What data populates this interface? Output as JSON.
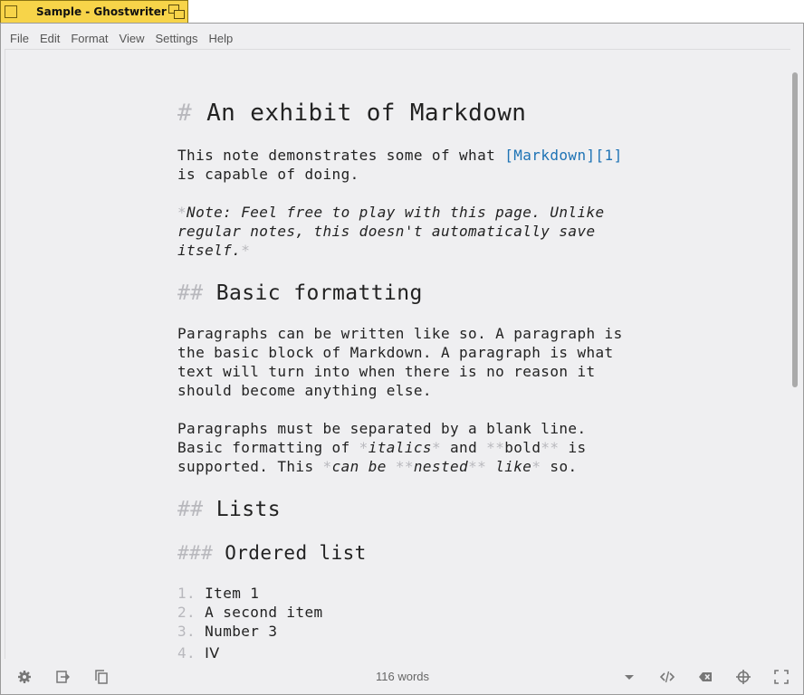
{
  "window": {
    "title": "Sample - Ghostwriter"
  },
  "menu": [
    "File",
    "Edit",
    "Format",
    "View",
    "Settings",
    "Help"
  ],
  "document": {
    "h1_marker": "#",
    "h1_text": "An exhibit of Markdown",
    "p1_line1_a": "This note demonstrates some of what ",
    "p1_link": "[Markdown][1]",
    "p1_line2": "is capable of doing.",
    "note_star_open": "*",
    "note_line1": "Note: Feel free to play with this page. Unlike",
    "note_line2": "regular notes, this doesn't automatically save",
    "note_line3": "itself.",
    "note_star_close": "*",
    "h2a_marker": "##",
    "h2a_text": "Basic formatting",
    "p2_line1": "Paragraphs can be written like so. A paragraph is",
    "p2_line2": "the basic block of Markdown. A paragraph is what",
    "p2_line3": "text will turn into when there is no reason it",
    "p2_line4": "should become anything else.",
    "p3_line1": "Paragraphs must be separated by a blank line.",
    "p3_l2_a": "Basic formatting of ",
    "p3_l2_star1": "*",
    "p3_l2_italics": "italics",
    "p3_l2_star2": "*",
    "p3_l2_and": " and ",
    "p3_l2_bstar1": "**",
    "p3_l2_bold": "bold",
    "p3_l2_bstar2": "**",
    "p3_l2_is": " is",
    "p3_l3_a": "supported. This ",
    "p3_l3_s1": "*",
    "p3_l3_canbe": "can be ",
    "p3_l3_bs1": "**",
    "p3_l3_nested": "nested",
    "p3_l3_bs2": "**",
    "p3_l3_like": " like",
    "p3_l3_s2": "*",
    "p3_l3_so": " so.",
    "h2b_marker": "##",
    "h2b_text": "Lists",
    "h3_marker": "###",
    "h3_text": "Ordered list",
    "list": [
      {
        "num": "1.",
        "text": "Item 1"
      },
      {
        "num": "2.",
        "text": "A second item"
      },
      {
        "num": "3.",
        "text": "Number 3"
      },
      {
        "num": "4.",
        "text": "IV"
      }
    ]
  },
  "status": {
    "word_count": "116 words"
  },
  "icons": [
    "gear-icon",
    "export-icon",
    "copy-icon",
    "dropdown-icon",
    "code-icon",
    "backspace-icon",
    "crosshair-icon",
    "fullscreen-icon"
  ]
}
